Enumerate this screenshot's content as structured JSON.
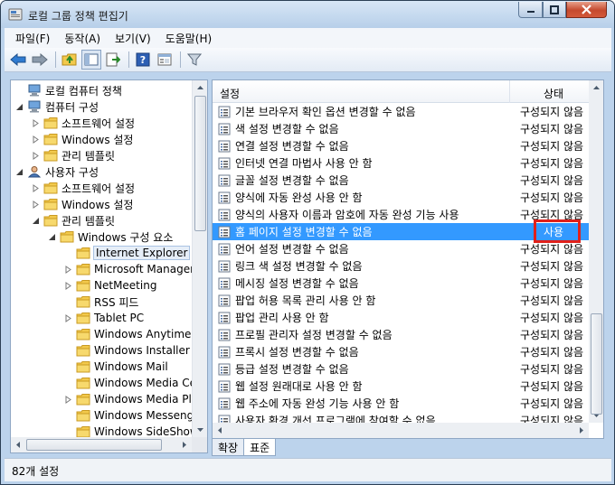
{
  "window": {
    "title": "로컬 그룹 정책 편집기"
  },
  "menu": [
    "파일(F)",
    "동작(A)",
    "보기(V)",
    "도움말(H)"
  ],
  "tree": {
    "items": [
      {
        "label": "로컬 컴퓨터 정책",
        "icon": "computer-icon"
      },
      {
        "label": "컴퓨터 구성",
        "icon": "computer-icon"
      },
      {
        "label": "소프트웨어 설정",
        "icon": "folder-icon"
      },
      {
        "label": "Windows 설정",
        "icon": "folder-icon"
      },
      {
        "label": "관리 템플릿",
        "icon": "folder-icon"
      },
      {
        "label": "사용자 구성",
        "icon": "user-icon"
      },
      {
        "label": "소프트웨어 설정",
        "icon": "folder-icon"
      },
      {
        "label": "Windows 설정",
        "icon": "folder-icon"
      },
      {
        "label": "관리 템플릿",
        "icon": "folder-icon"
      },
      {
        "label": "Windows 구성 요소",
        "icon": "folder-icon"
      },
      {
        "label": "Internet Explorer",
        "icon": "folder-icon"
      },
      {
        "label": "Microsoft Management",
        "icon": "folder-icon"
      },
      {
        "label": "NetMeeting",
        "icon": "folder-icon"
      },
      {
        "label": "RSS 피드",
        "icon": "folder-icon"
      },
      {
        "label": "Tablet PC",
        "icon": "folder-icon"
      },
      {
        "label": "Windows Anytime Up",
        "icon": "folder-icon"
      },
      {
        "label": "Windows Installer",
        "icon": "folder-icon"
      },
      {
        "label": "Windows Mail",
        "icon": "folder-icon"
      },
      {
        "label": "Windows Media Cent",
        "icon": "folder-icon"
      },
      {
        "label": "Windows Media Playe",
        "icon": "folder-icon"
      },
      {
        "label": "Windows Messenger",
        "icon": "folder-icon"
      },
      {
        "label": "Windows SideShow",
        "icon": "folder-icon"
      }
    ]
  },
  "list": {
    "header_name": "설정",
    "header_state": "상태",
    "rows": [
      {
        "name": "기본 브라우저 확인 옵션 변경할 수 없음",
        "state": "구성되지 않음"
      },
      {
        "name": "색 설정 변경할 수 없음",
        "state": "구성되지 않음"
      },
      {
        "name": "연결 설정 변경할 수 없음",
        "state": "구성되지 않음"
      },
      {
        "name": "인터넷 연결 마법사 사용 안 함",
        "state": "구성되지 않음"
      },
      {
        "name": "글꼴 설정 변경할 수 없음",
        "state": "구성되지 않음"
      },
      {
        "name": "양식에 자동 완성 사용 안 함",
        "state": "구성되지 않음"
      },
      {
        "name": "양식의 사용자 이름과 암호에 자동 완성 기능 사용",
        "state": "구성되지 않음"
      },
      {
        "name": "홈 페이지 설정 변경할 수 없음",
        "state": "사용"
      },
      {
        "name": "언어 설정 변경할 수 없음",
        "state": "구성되지 않음"
      },
      {
        "name": "링크 색 설정 변경할 수 없음",
        "state": "구성되지 않음"
      },
      {
        "name": "메시징 설정 변경할 수 없음",
        "state": "구성되지 않음"
      },
      {
        "name": "팝업 허용 목록 관리 사용 안 함",
        "state": "구성되지 않음"
      },
      {
        "name": "팝업 관리 사용 안 함",
        "state": "구성되지 않음"
      },
      {
        "name": "프로필 관리자 설정 변경할 수 없음",
        "state": "구성되지 않음"
      },
      {
        "name": "프록시 설정 변경할 수 없음",
        "state": "구성되지 않음"
      },
      {
        "name": "등급 설정 변경할 수 없음",
        "state": "구성되지 않음"
      },
      {
        "name": "웹 설정 원래대로 사용 안 함",
        "state": "구성되지 않음"
      },
      {
        "name": "웹 주소에 자동 완성 기능 사용 안 함",
        "state": "구성되지 않음"
      },
      {
        "name": "사용자 환경 개선 프로그램에 참여할 수 없음",
        "state": "구성되지 않음"
      }
    ]
  },
  "tabs": [
    "확장",
    "표준"
  ],
  "status": "82개 설정",
  "colors": {
    "selection": "#3399ff",
    "highlight_box": "#e0201a",
    "folder": "#f2c94c"
  }
}
